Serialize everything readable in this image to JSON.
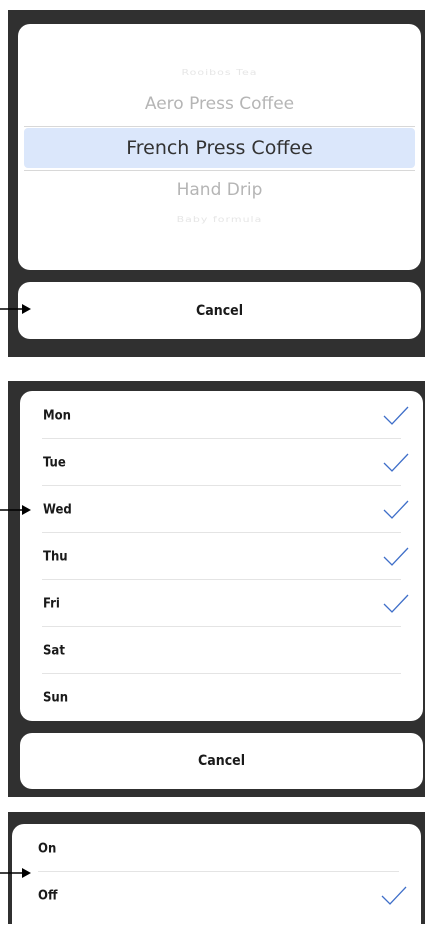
{
  "picker": {
    "items": [
      {
        "label": "Rooibos Tea"
      },
      {
        "label": "Aero Press Coffee"
      },
      {
        "label": "French Press Coffee",
        "selected": true
      },
      {
        "label": "Hand Drip"
      },
      {
        "label": "Baby formula"
      }
    ],
    "cancel_label": "Cancel"
  },
  "days": {
    "items": [
      {
        "label": "Mon",
        "checked": true
      },
      {
        "label": "Tue",
        "checked": true
      },
      {
        "label": "Wed",
        "checked": true
      },
      {
        "label": "Thu",
        "checked": true
      },
      {
        "label": "Fri",
        "checked": true
      },
      {
        "label": "Sat",
        "checked": false
      },
      {
        "label": "Sun",
        "checked": false
      }
    ],
    "cancel_label": "Cancel"
  },
  "onoff": {
    "items": [
      {
        "label": "On",
        "checked": false
      },
      {
        "label": "Off",
        "checked": true
      }
    ]
  },
  "colors": {
    "panel_bg": "#303030",
    "check": "#3f6fc9",
    "selection_band": "#dbe7fb"
  },
  "icons": {
    "check": "checkmark-icon",
    "pointer": "arrow-right-icon"
  }
}
